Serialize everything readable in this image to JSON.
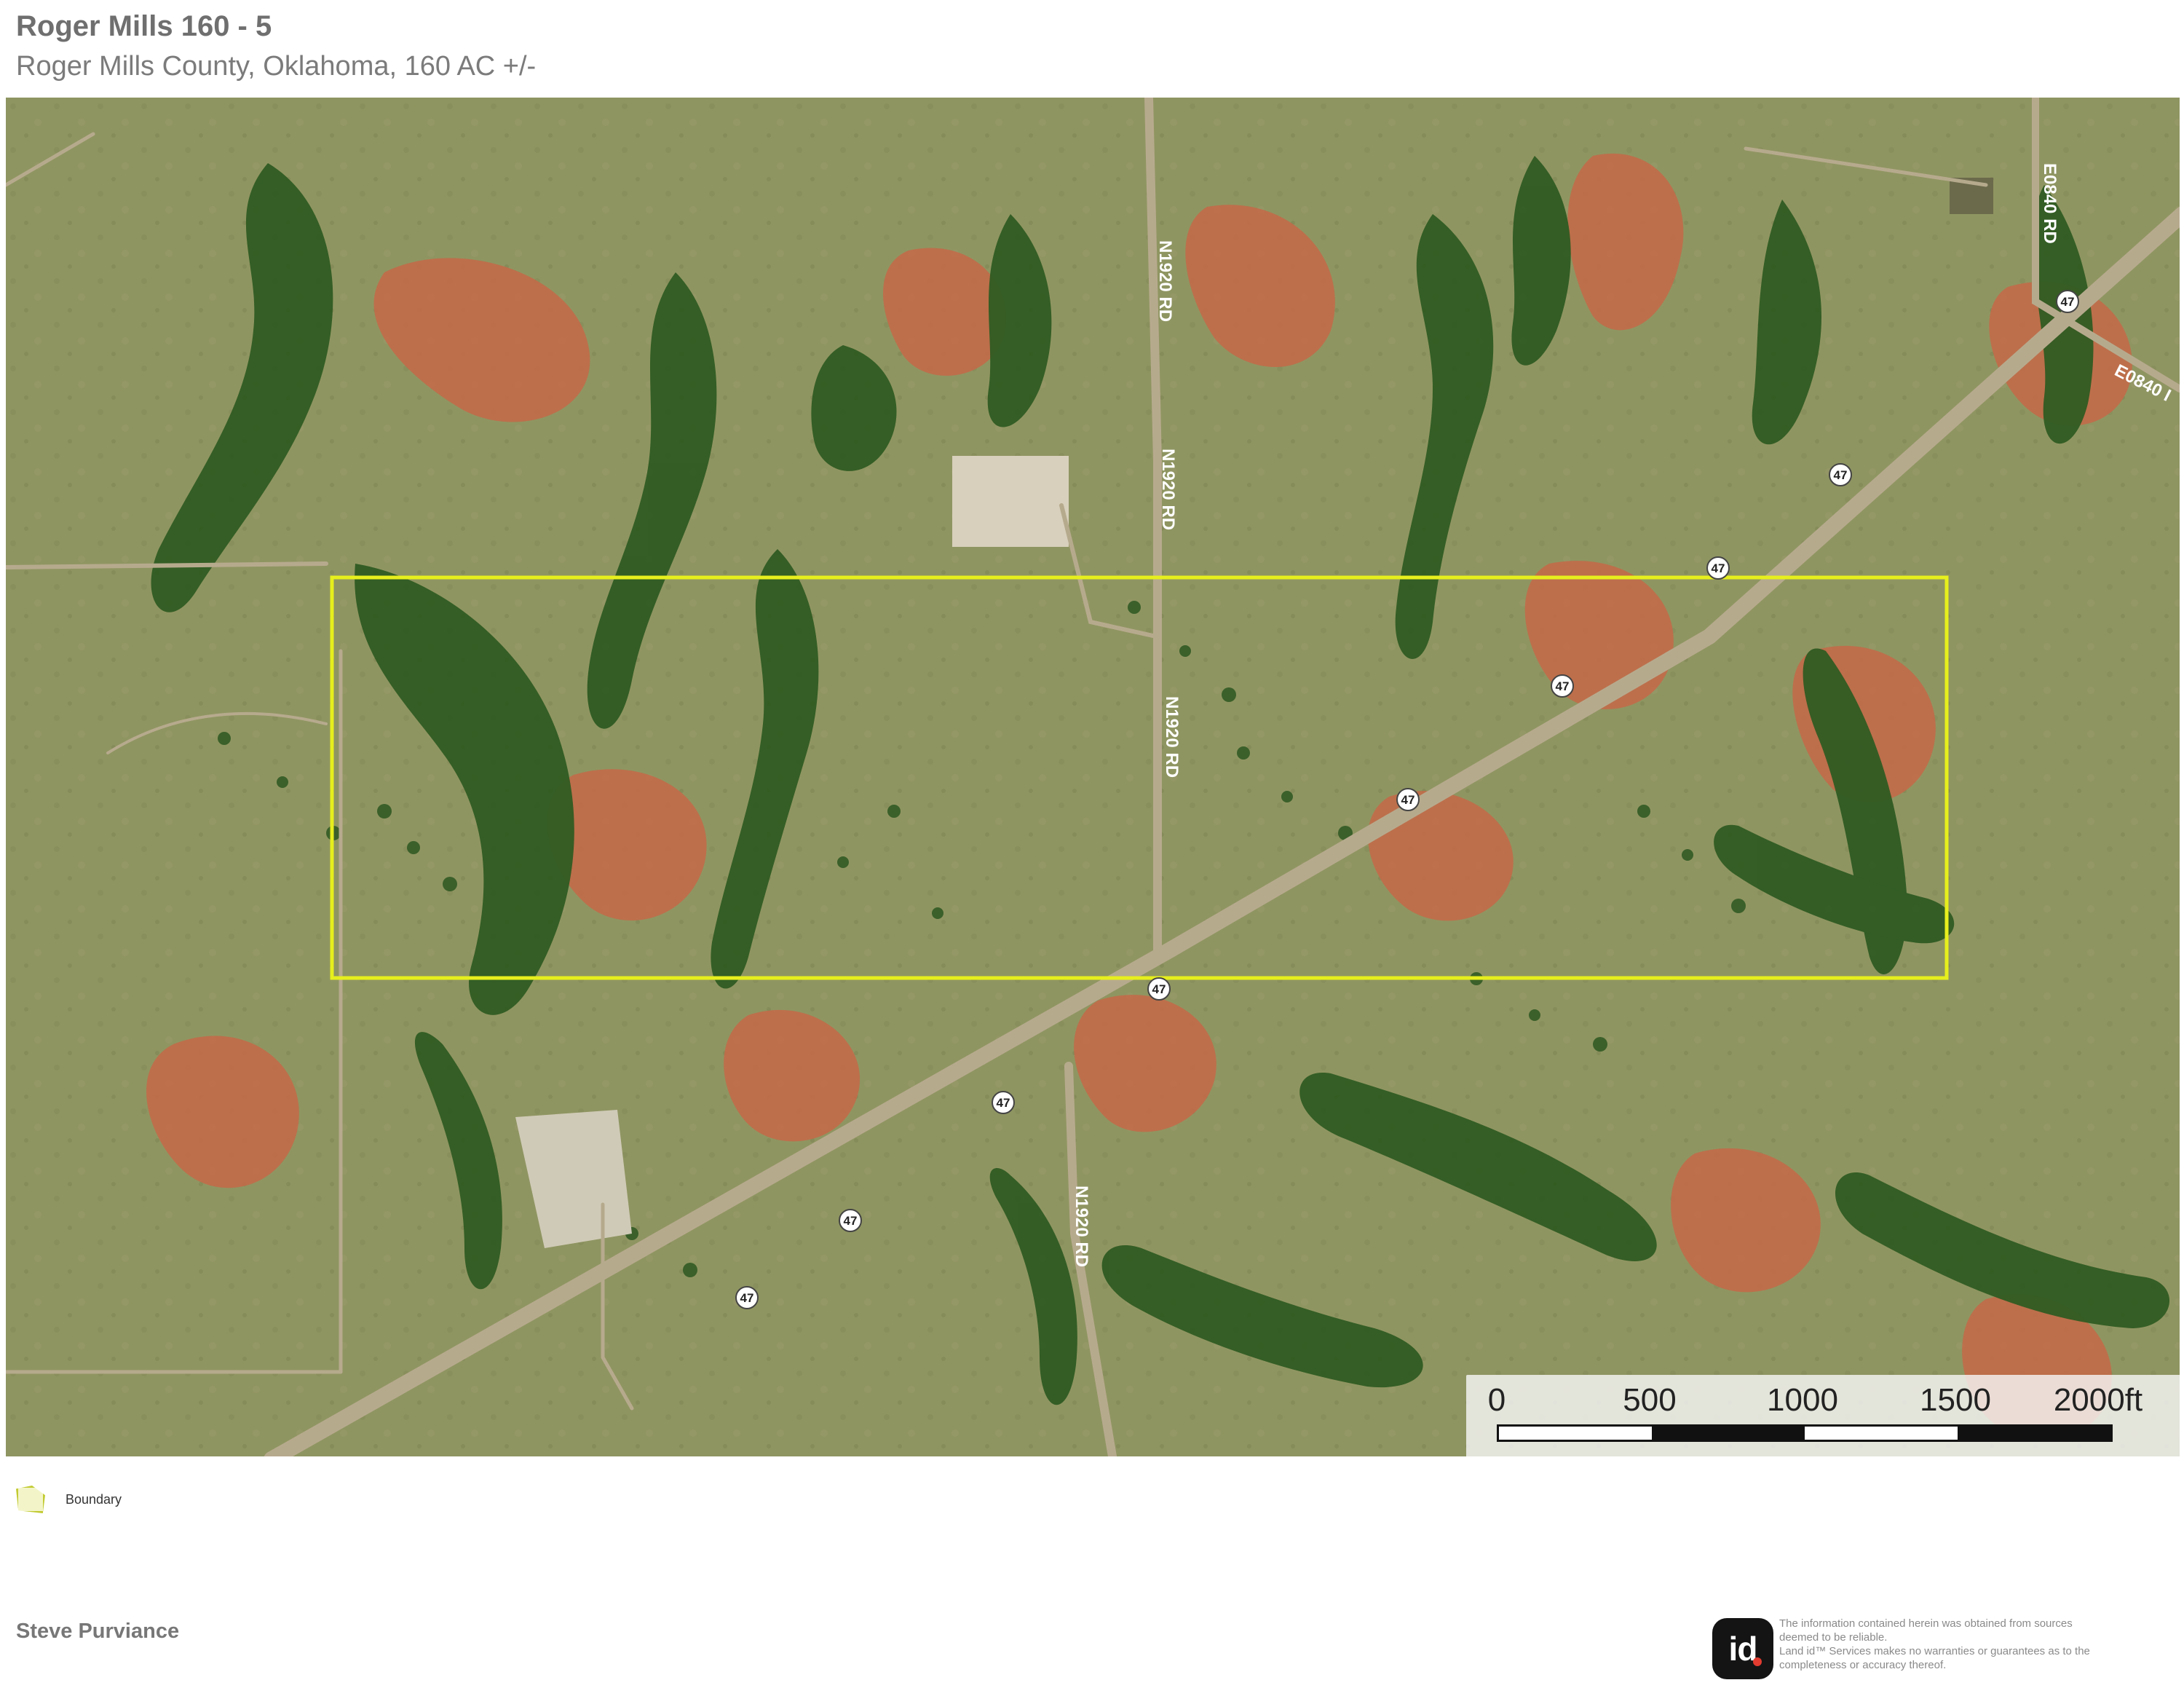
{
  "header": {
    "title": "Roger Mills 160 - 5",
    "subtitle": "Roger Mills County, Oklahoma, 160 AC +/-"
  },
  "map": {
    "basemap": "satellite imagery",
    "colors": {
      "terrain_base": "#8f9561",
      "red_soil": "#c66848",
      "trees": "#2f5b22",
      "road": "#b6aa8d",
      "boundary": "#e7ef1d"
    },
    "road_labels": {
      "n1920_top": "N1920 RD",
      "n1920_middle": "N1920 RD",
      "n1920_lower": "N1920 RD",
      "n1920_bottom": "N1920 RD",
      "e0840_vertical": "E0840 RD",
      "e0840_diagonal": "E0840 I"
    },
    "route_shield": "47"
  },
  "scale_bar": {
    "labels": [
      "0",
      "500",
      "1000",
      "1500",
      "2000ft"
    ]
  },
  "legend": {
    "boundary_label": "Boundary"
  },
  "footer": {
    "name": "Steve Purviance",
    "logo_text": "id",
    "disclaimer": [
      "The information contained herein was obtained from sources",
      "deemed to be reliable.",
      "Land id™ Services makes no warranties or guarantees as to the",
      "completeness or accuracy thereof."
    ]
  }
}
